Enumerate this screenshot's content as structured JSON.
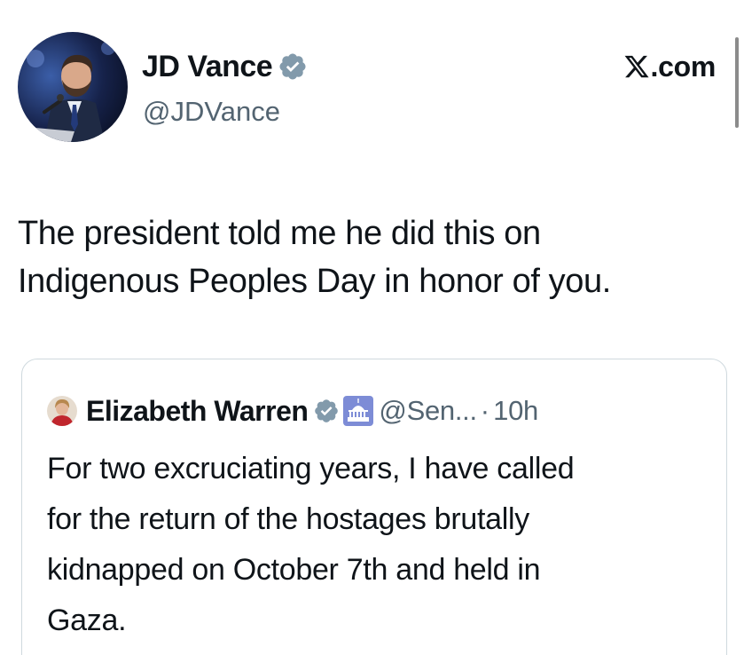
{
  "author": {
    "display_name": "JD Vance",
    "handle": "@JDVance",
    "verified_icon": "verified-badge-icon",
    "avatar_icon": "avatar"
  },
  "source": {
    "site": ".com",
    "logo_icon": "x-logo-icon"
  },
  "tweet": {
    "lines": [
      "The president told me he did this on",
      "Indigenous Peoples Day in honor of you."
    ]
  },
  "quoted_tweet": {
    "display_name": "Elizabeth Warren",
    "handle": "@Sen...",
    "separator": "·",
    "time": "10h",
    "lines": [
      "For two excruciating years, I have called",
      "for the return of the hostages brutally",
      "kidnapped on October 7th and held in",
      "Gaza."
    ]
  },
  "colors": {
    "text": "#0f1419",
    "secondary": "#536471",
    "verified": "#829aab",
    "border": "#cfd9de"
  }
}
